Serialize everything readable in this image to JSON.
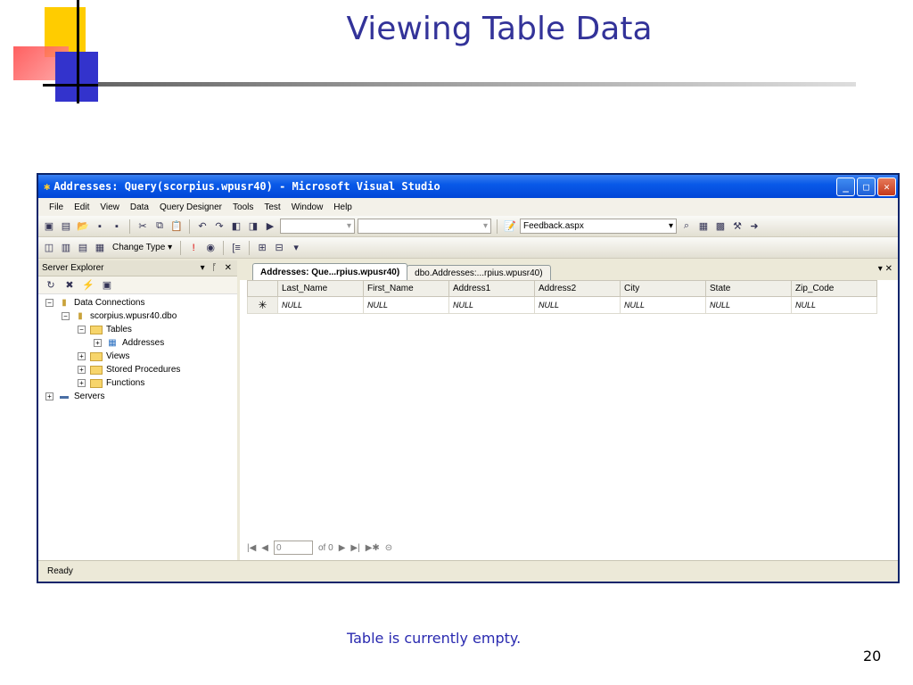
{
  "slide": {
    "title": "Viewing Table Data",
    "caption": "Table is currently empty.",
    "page_number": "20"
  },
  "window": {
    "title": "Addresses: Query(scorpius.wpusr40) - Microsoft Visual Studio",
    "minimize_icon": "minimize-icon",
    "maximize_icon": "maximize-icon",
    "close_icon": "close-icon"
  },
  "menu": [
    "File",
    "Edit",
    "View",
    "Data",
    "Query Designer",
    "Tools",
    "Test",
    "Window",
    "Help"
  ],
  "toolbar1": {
    "combo1_value": "",
    "combo2_value": "",
    "find_value": "Feedback.aspx"
  },
  "toolbar2": {
    "change_type_label": "Change Type"
  },
  "server_explorer": {
    "header": "Server Explorer",
    "tree": [
      {
        "label": "Data Connections",
        "level": 0,
        "expander": "−",
        "icon": "data-connections-icon"
      },
      {
        "label": "scorpius.wpusr40.dbo",
        "level": 1,
        "expander": "−",
        "icon": "database-icon"
      },
      {
        "label": "Tables",
        "level": 2,
        "expander": "−",
        "icon": "folder-icon"
      },
      {
        "label": "Addresses",
        "level": 3,
        "expander": "+",
        "icon": "table-icon"
      },
      {
        "label": "Views",
        "level": 2,
        "expander": "+",
        "icon": "folder-icon"
      },
      {
        "label": "Stored Procedures",
        "level": 2,
        "expander": "+",
        "icon": "folder-icon"
      },
      {
        "label": "Functions",
        "level": 2,
        "expander": "+",
        "icon": "folder-icon"
      },
      {
        "label": "Servers",
        "level": 0,
        "expander": "+",
        "icon": "servers-icon"
      }
    ]
  },
  "tabs": [
    {
      "label": "Addresses: Que...rpius.wpusr40)",
      "active": true
    },
    {
      "label": "dbo.Addresses:...rpius.wpusr40)",
      "active": false
    }
  ],
  "grid": {
    "columns": [
      "Last_Name",
      "First_Name",
      "Address1",
      "Address2",
      "City",
      "State",
      "Zip_Code"
    ],
    "new_row_marker": "✳",
    "new_row_values": [
      "NULL",
      "NULL",
      "NULL",
      "NULL",
      "NULL",
      "NULL",
      "NULL"
    ]
  },
  "navigation": {
    "record_value": "0",
    "of_text": "of 0"
  },
  "status": "Ready"
}
